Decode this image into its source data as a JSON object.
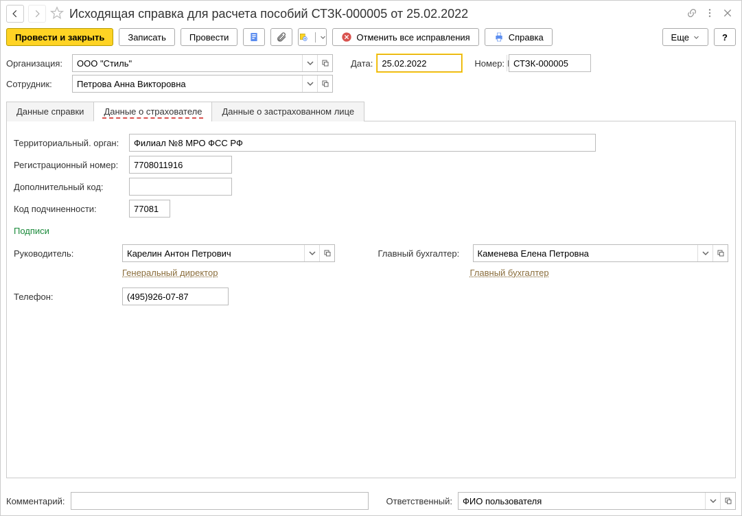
{
  "title": "Исходящая справка для расчета пособий СТЗК-000005 от 25.02.2022",
  "toolbar": {
    "post_close": "Провести и закрыть",
    "save": "Записать",
    "post": "Провести",
    "cancel_corr": "Отменить все исправления",
    "reference": "Справка",
    "more": "Еще",
    "help": "?"
  },
  "header": {
    "org_label": "Организация:",
    "org_value": "ООО \"Стиль\"",
    "date_label": "Дата:",
    "date_value": "25.02.2022",
    "number_label": "Номер:",
    "number_value": "СТЗК-000005",
    "employee_label": "Сотрудник:",
    "employee_value": "Петрова Анна Викторовна"
  },
  "tabs": {
    "t1": "Данные справки",
    "t2": "Данные о страхователе",
    "t3": "Данные о застрахованном лице"
  },
  "insurer": {
    "territorial_label": "Территориальный. орган:",
    "territorial_value": "Филиал №8 МРО ФСС РФ",
    "regnum_label": "Регистрационный номер:",
    "regnum_value": "7708011916",
    "addcode_label": "Дополнительный код:",
    "addcode_value": "",
    "subcode_label": "Код подчиненности:",
    "subcode_value": "77081",
    "signatures": "Подписи",
    "director_label": "Руководитель:",
    "director_value": "Карелин Антон Петрович",
    "director_link": "Генеральный директор",
    "accountant_label": "Главный бухгалтер:",
    "accountant_value": "Каменева Елена Петровна",
    "accountant_link": "Главный бухгалтер",
    "phone_label": "Телефон:",
    "phone_value": "(495)926-07-87"
  },
  "footer": {
    "comment_label": "Комментарий:",
    "comment_value": "",
    "responsible_label": "Ответственный:",
    "responsible_value": "ФИО пользователя"
  }
}
